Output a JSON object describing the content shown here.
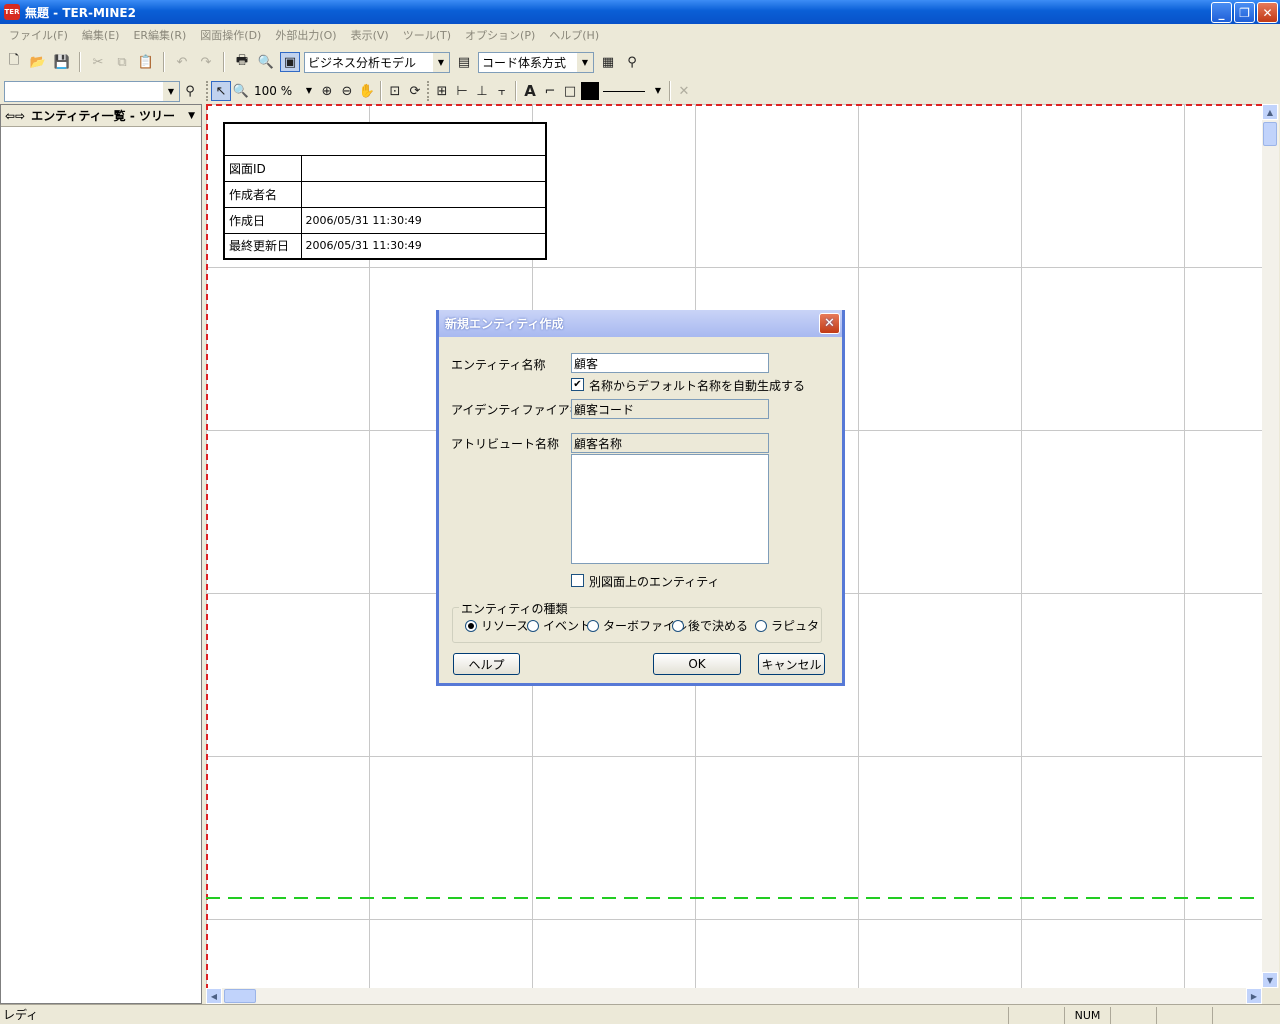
{
  "window": {
    "title": "無題 - TER-MINE2",
    "app_icon": "TER",
    "minimize": "_",
    "maximize": "❐",
    "close": "✕"
  },
  "menu": [
    "ファイル(F)",
    "編集(E)",
    "ER編集(R)",
    "図面操作(D)",
    "外部出力(O)",
    "表示(V)",
    "ツール(T)",
    "オプション(P)",
    "ヘルプ(H)"
  ],
  "toolbar": {
    "model_combo": "ビジネス分析モデル",
    "code_combo": "コード体系方式",
    "zoom_value": "100 %"
  },
  "left_pane": {
    "header": "エンティティ一覧 - ツリー",
    "search_value": ""
  },
  "info_table": {
    "title": "",
    "rows": [
      {
        "label": "図面ID",
        "value": ""
      },
      {
        "label": "作成者名",
        "value": ""
      },
      {
        "label": "作成日",
        "value": "2006/05/31 11:30:49"
      },
      {
        "label": "最終更新日",
        "value": "2006/05/31 11:30:49"
      }
    ]
  },
  "dialog": {
    "title": "新規エンティティ作成",
    "entity_name_label": "エンティティ名称",
    "entity_name_value": "顧客",
    "auto_name_checkbox_label": "名称からデフォルト名称を自動生成する",
    "auto_name_checked": true,
    "identifier_label": "アイデンティファイア名称",
    "identifier_value": "顧客コード",
    "attribute_label": "アトリビュート名称",
    "attribute_value": "顧客名称",
    "other_diagram_label": "別図面上のエンティティ",
    "other_diagram_checked": false,
    "entity_type_group": "エンティティの種類",
    "entity_types": [
      "リソース",
      "イベント",
      "ターボファイル",
      "後で決める",
      "ラピュタ"
    ],
    "selected_type": "リソース",
    "help_button": "ヘルプ",
    "ok_button": "OK",
    "cancel_button": "キャンセル"
  },
  "status": {
    "text": "レディ",
    "num": "NUM"
  }
}
